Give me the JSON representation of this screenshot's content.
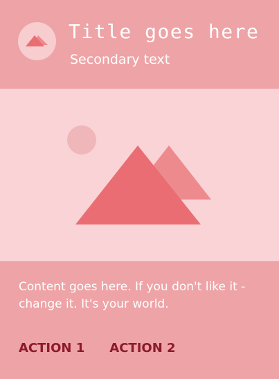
{
  "header": {
    "title": "Title goes here",
    "subtitle": "Secondary text"
  },
  "content": {
    "body": "Content goes here. If you don't like it - change it. It's your world."
  },
  "actions": {
    "action1_label": "ACTION 1",
    "action2_label": "ACTION 2"
  },
  "icons": {
    "avatar": "mountain-icon",
    "media": "mountain-landscape-icon"
  },
  "colors": {
    "card_background": "#EEA3A6",
    "media_background": "#F9D3D5",
    "mountain_primary": "#E96D73",
    "mountain_secondary": "#ED8A8E",
    "sun": "#EFB7B9",
    "action_text": "#8C1A2B",
    "text": "#FFFFFF"
  }
}
